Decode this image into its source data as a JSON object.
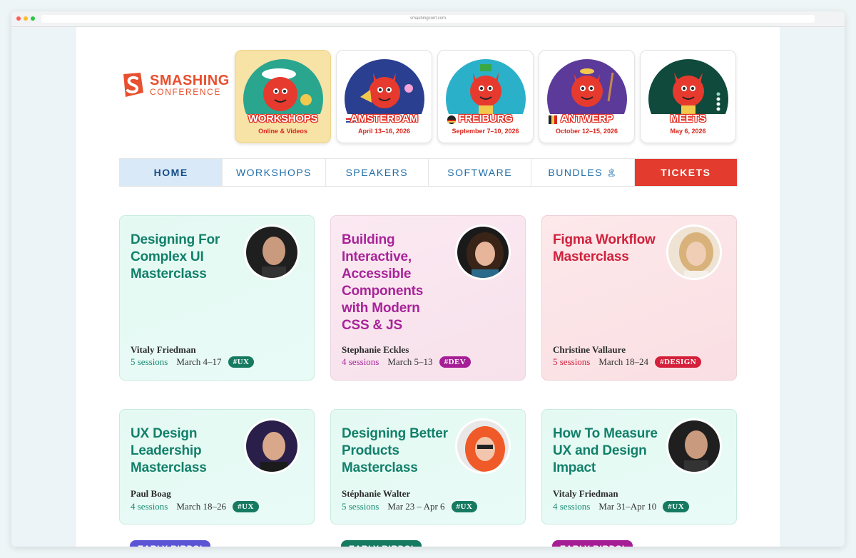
{
  "browser": {
    "url": "smashingconf.com",
    "dot_colors": [
      "#ff5f57",
      "#febc2e",
      "#28c840"
    ]
  },
  "logo": {
    "line1": "SMASHING",
    "line2": "CONFERENCE",
    "color": "#e8502f"
  },
  "events": [
    {
      "title": "WORKSHOPS",
      "subtitle": "Online & Videos",
      "bg": "#2aa68f",
      "active": true
    },
    {
      "title": "AMSTERDAM",
      "subtitle": "April 13–16, 2026",
      "bg": "#2a3f8f",
      "flag": "netherlands"
    },
    {
      "title": "FREIBURG",
      "subtitle": "September 7–10, 2026",
      "bg": "#2bb0c9",
      "flag": "germany"
    },
    {
      "title": "ANTWERP",
      "subtitle": "October 12–15, 2026",
      "bg": "#5b3a9a",
      "flag": "belgium"
    },
    {
      "title": "MEETS",
      "subtitle": "May 6, 2026",
      "bg": "#0f4a3c"
    }
  ],
  "nav": {
    "home": "HOME",
    "workshops": "WORKSHOPS",
    "speakers": "SPEAKERS",
    "software": "SOFTWARE",
    "bundles": "BUNDLES",
    "bundles_icon": "palm-tree-icon",
    "tickets": "TICKETS"
  },
  "workshops": [
    {
      "title": "Designing For Complex UI Masterclass",
      "author": "Vitaly Friedman",
      "sessions": "5 sessions",
      "dates": "March 4–17",
      "tag": "#UX",
      "theme": "green"
    },
    {
      "title": "Building Interactive, Accessible Components with Modern CSS & JS",
      "author": "Stephanie Eckles",
      "sessions": "4 sessions",
      "dates": "March 5–13",
      "tag": "#DEV",
      "theme": "pink"
    },
    {
      "title": "Figma Workflow Masterclass",
      "author": "Christine Vallaure",
      "sessions": "5 sessions",
      "dates": "March 18–24",
      "tag": "#DESIGN",
      "theme": "red"
    },
    {
      "title": "UX Design Leadership Masterclass",
      "author": "Paul Boag",
      "sessions": "4 sessions",
      "dates": "March 18–26",
      "tag": "#UX",
      "theme": "green"
    },
    {
      "title": "Designing Better Products Masterclass",
      "author": "Stéphanie Walter",
      "sessions": "5 sessions",
      "dates": "Mar 23 – Apr 6",
      "tag": "#UX",
      "theme": "green"
    },
    {
      "title": "How To Measure UX and Design Impact",
      "author": "Vitaly Friedman",
      "sessions": "4 sessions",
      "dates": "Mar 31–Apr 10",
      "tag": "#UX",
      "theme": "green"
    }
  ],
  "early_birds": [
    {
      "label": "EARLY BIRDS!",
      "color": "#5b55d6"
    },
    {
      "label": "EARLY BIRDS!",
      "color": "#167a61"
    },
    {
      "label": "EARLY BIRDS!",
      "color": "#a61e95"
    }
  ]
}
